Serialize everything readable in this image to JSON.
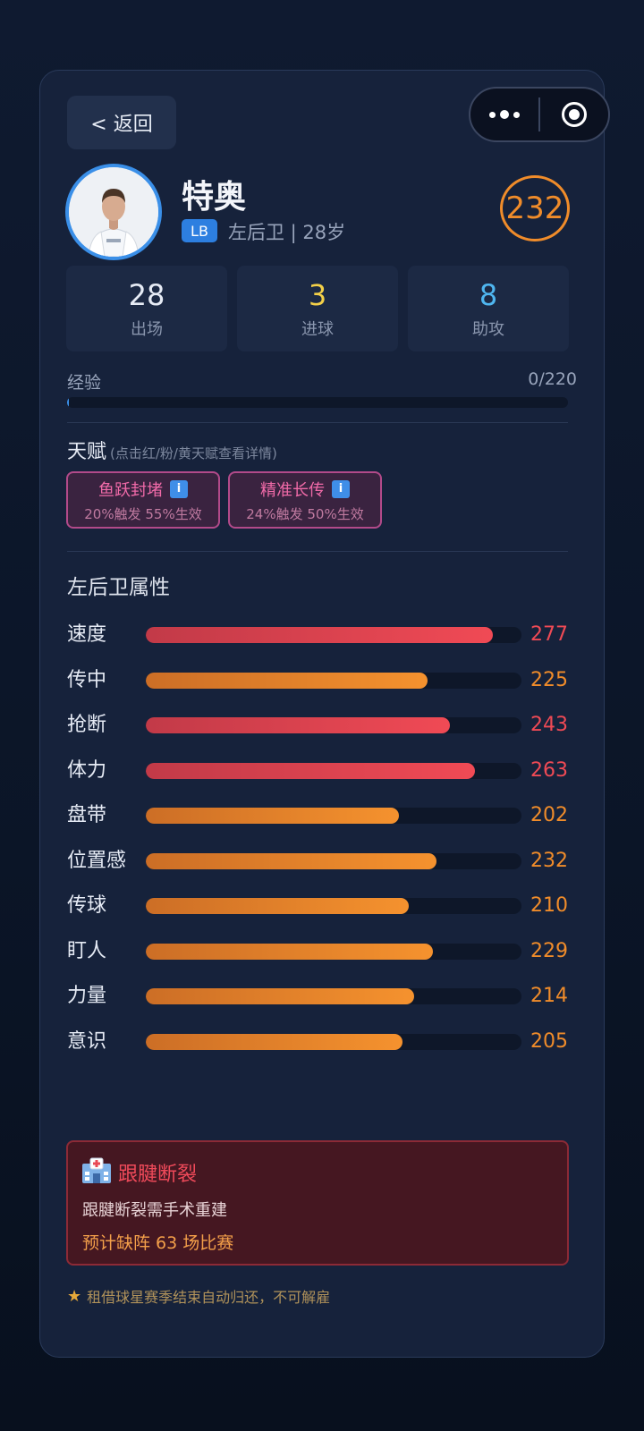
{
  "nav": {
    "back_label": "< 返回"
  },
  "player": {
    "name": "特奥",
    "position_badge": "LB",
    "meta": "左后卫 | 28岁",
    "rating": "232",
    "avatar_alt": "player-photo"
  },
  "stats": [
    {
      "value": "28",
      "label": "出场",
      "color": "#e6ebf5"
    },
    {
      "value": "3",
      "label": "进球",
      "color": "#f4d048"
    },
    {
      "value": "8",
      "label": "助攻",
      "color": "#4fb6f0"
    }
  ],
  "experience": {
    "label": "经验",
    "value": "0/220",
    "current": 0,
    "max": 220
  },
  "talents": {
    "title": "天赋",
    "hint": "(点击红/粉/黄天赋查看详情)",
    "items": [
      {
        "name": "鱼跃封堵",
        "effect": "20%触发 55%生效"
      },
      {
        "name": "精准长传",
        "effect": "24%触发 50%生效"
      }
    ]
  },
  "attributes": {
    "title": "左后卫属性",
    "max": 300,
    "items": [
      {
        "name": "速度",
        "value": 277,
        "tier": "red"
      },
      {
        "name": "传中",
        "value": 225,
        "tier": "orange"
      },
      {
        "name": "抢断",
        "value": 243,
        "tier": "red"
      },
      {
        "name": "体力",
        "value": 263,
        "tier": "red"
      },
      {
        "name": "盘带",
        "value": 202,
        "tier": "orange"
      },
      {
        "name": "位置感",
        "value": 232,
        "tier": "orange"
      },
      {
        "name": "传球",
        "value": 210,
        "tier": "orange"
      },
      {
        "name": "盯人",
        "value": 229,
        "tier": "orange"
      },
      {
        "name": "力量",
        "value": 214,
        "tier": "orange"
      },
      {
        "name": "意识",
        "value": 205,
        "tier": "orange"
      }
    ]
  },
  "injury": {
    "title": "跟腱断裂",
    "description": "跟腱断裂需手术重建",
    "missing": "预计缺阵 63 场比赛"
  },
  "footer": {
    "note": "租借球星赛季结束自动归还，不可解雇"
  },
  "colors": {
    "accent": "#3a8fe8",
    "rating": "#f08c2a",
    "red_tier_value": "#f04a55",
    "orange_tier_value": "#f08c2a"
  }
}
